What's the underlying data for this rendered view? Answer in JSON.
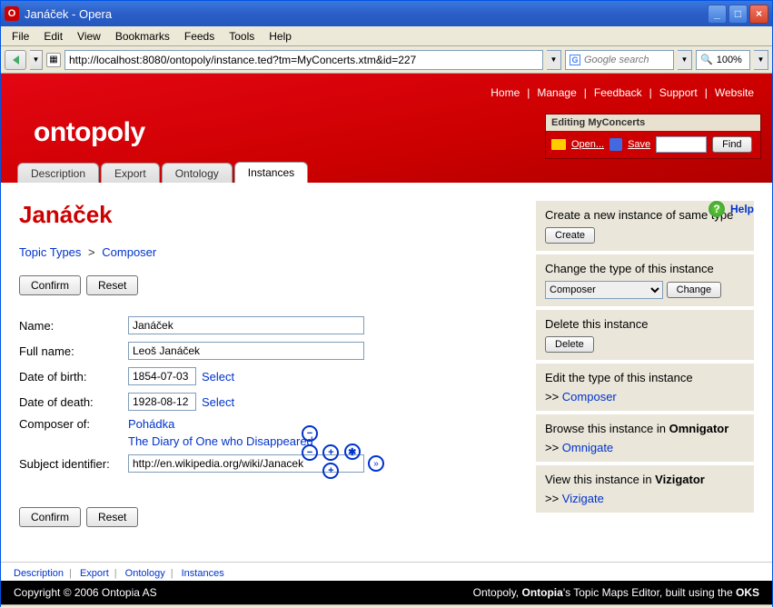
{
  "window": {
    "title": "Janáček - Opera",
    "app_initial": "O"
  },
  "menubar": [
    "File",
    "Edit",
    "View",
    "Bookmarks",
    "Feeds",
    "Tools",
    "Help"
  ],
  "toolbar": {
    "url": "http://localhost:8080/ontopoly/instance.ted?tm=MyConcerts.xtm&id=227",
    "search_placeholder": "Google search",
    "zoom": "100%"
  },
  "topnav": [
    "Home",
    "Manage",
    "Feedback",
    "Support",
    "Website"
  ],
  "logo": "ontopoly",
  "edit_panel": {
    "title": "Editing MyConcerts",
    "open": "Open...",
    "save": "Save",
    "find": "Find"
  },
  "tabs": [
    "Description",
    "Export",
    "Ontology",
    "Instances"
  ],
  "active_tab": 3,
  "page_title": "Janáček",
  "help": "Help",
  "breadcrumb": {
    "root": "Topic Types",
    "leaf": "Composer"
  },
  "buttons": {
    "confirm": "Confirm",
    "reset": "Reset"
  },
  "form": {
    "name_label": "Name:",
    "name_value": "Janáček",
    "fullname_label": "Full name:",
    "fullname_value": "Leoš Janáček",
    "dob_label": "Date of birth:",
    "dob_value": "1854-07-03",
    "dod_label": "Date of death:",
    "dod_value": "1928-08-12",
    "select": "Select",
    "composer_label": "Composer of:",
    "composer_items": [
      "Pohádka",
      "The Diary of One who Disappeared"
    ],
    "subject_label": "Subject identifier:",
    "subject_value": "http://en.wikipedia.org/wiki/Janacek"
  },
  "sidebar": {
    "create": {
      "title": "Create a new instance of same type",
      "btn": "Create"
    },
    "change": {
      "title": "Change the type of this instance",
      "select": "Composer",
      "btn": "Change"
    },
    "delete": {
      "title": "Delete this instance",
      "btn": "Delete"
    },
    "edit": {
      "title": "Edit the type of this instance",
      "link": "Composer"
    },
    "browse": {
      "title_a": "Browse this instance in ",
      "title_b": "Omnigator",
      "link": "Omnigate"
    },
    "view": {
      "title_a": "View this instance in ",
      "title_b": "Vizigator",
      "link": "Vizigate"
    }
  },
  "footer_tabs": [
    "Description",
    "Export",
    "Ontology",
    "Instances"
  ],
  "footer": {
    "left": "Copyright © 2006 Ontopia AS",
    "right_a": "Ontopoly, ",
    "right_b": "Ontopia",
    "right_c": "'s Topic Maps Editor, built using the ",
    "right_d": "OKS"
  }
}
